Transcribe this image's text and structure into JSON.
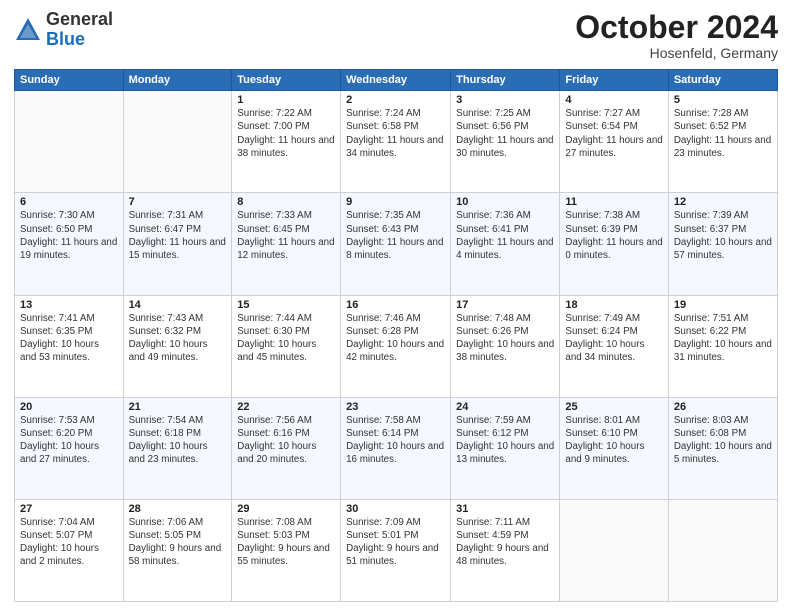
{
  "header": {
    "logo_general": "General",
    "logo_blue": "Blue",
    "month_title": "October 2024",
    "location": "Hosenfeld, Germany"
  },
  "weekdays": [
    "Sunday",
    "Monday",
    "Tuesday",
    "Wednesday",
    "Thursday",
    "Friday",
    "Saturday"
  ],
  "weeks": [
    [
      {
        "day": "",
        "info": ""
      },
      {
        "day": "",
        "info": ""
      },
      {
        "day": "1",
        "info": "Sunrise: 7:22 AM\nSunset: 7:00 PM\nDaylight: 11 hours and 38 minutes."
      },
      {
        "day": "2",
        "info": "Sunrise: 7:24 AM\nSunset: 6:58 PM\nDaylight: 11 hours and 34 minutes."
      },
      {
        "day": "3",
        "info": "Sunrise: 7:25 AM\nSunset: 6:56 PM\nDaylight: 11 hours and 30 minutes."
      },
      {
        "day": "4",
        "info": "Sunrise: 7:27 AM\nSunset: 6:54 PM\nDaylight: 11 hours and 27 minutes."
      },
      {
        "day": "5",
        "info": "Sunrise: 7:28 AM\nSunset: 6:52 PM\nDaylight: 11 hours and 23 minutes."
      }
    ],
    [
      {
        "day": "6",
        "info": "Sunrise: 7:30 AM\nSunset: 6:50 PM\nDaylight: 11 hours and 19 minutes."
      },
      {
        "day": "7",
        "info": "Sunrise: 7:31 AM\nSunset: 6:47 PM\nDaylight: 11 hours and 15 minutes."
      },
      {
        "day": "8",
        "info": "Sunrise: 7:33 AM\nSunset: 6:45 PM\nDaylight: 11 hours and 12 minutes."
      },
      {
        "day": "9",
        "info": "Sunrise: 7:35 AM\nSunset: 6:43 PM\nDaylight: 11 hours and 8 minutes."
      },
      {
        "day": "10",
        "info": "Sunrise: 7:36 AM\nSunset: 6:41 PM\nDaylight: 11 hours and 4 minutes."
      },
      {
        "day": "11",
        "info": "Sunrise: 7:38 AM\nSunset: 6:39 PM\nDaylight: 11 hours and 0 minutes."
      },
      {
        "day": "12",
        "info": "Sunrise: 7:39 AM\nSunset: 6:37 PM\nDaylight: 10 hours and 57 minutes."
      }
    ],
    [
      {
        "day": "13",
        "info": "Sunrise: 7:41 AM\nSunset: 6:35 PM\nDaylight: 10 hours and 53 minutes."
      },
      {
        "day": "14",
        "info": "Sunrise: 7:43 AM\nSunset: 6:32 PM\nDaylight: 10 hours and 49 minutes."
      },
      {
        "day": "15",
        "info": "Sunrise: 7:44 AM\nSunset: 6:30 PM\nDaylight: 10 hours and 45 minutes."
      },
      {
        "day": "16",
        "info": "Sunrise: 7:46 AM\nSunset: 6:28 PM\nDaylight: 10 hours and 42 minutes."
      },
      {
        "day": "17",
        "info": "Sunrise: 7:48 AM\nSunset: 6:26 PM\nDaylight: 10 hours and 38 minutes."
      },
      {
        "day": "18",
        "info": "Sunrise: 7:49 AM\nSunset: 6:24 PM\nDaylight: 10 hours and 34 minutes."
      },
      {
        "day": "19",
        "info": "Sunrise: 7:51 AM\nSunset: 6:22 PM\nDaylight: 10 hours and 31 minutes."
      }
    ],
    [
      {
        "day": "20",
        "info": "Sunrise: 7:53 AM\nSunset: 6:20 PM\nDaylight: 10 hours and 27 minutes."
      },
      {
        "day": "21",
        "info": "Sunrise: 7:54 AM\nSunset: 6:18 PM\nDaylight: 10 hours and 23 minutes."
      },
      {
        "day": "22",
        "info": "Sunrise: 7:56 AM\nSunset: 6:16 PM\nDaylight: 10 hours and 20 minutes."
      },
      {
        "day": "23",
        "info": "Sunrise: 7:58 AM\nSunset: 6:14 PM\nDaylight: 10 hours and 16 minutes."
      },
      {
        "day": "24",
        "info": "Sunrise: 7:59 AM\nSunset: 6:12 PM\nDaylight: 10 hours and 13 minutes."
      },
      {
        "day": "25",
        "info": "Sunrise: 8:01 AM\nSunset: 6:10 PM\nDaylight: 10 hours and 9 minutes."
      },
      {
        "day": "26",
        "info": "Sunrise: 8:03 AM\nSunset: 6:08 PM\nDaylight: 10 hours and 5 minutes."
      }
    ],
    [
      {
        "day": "27",
        "info": "Sunrise: 7:04 AM\nSunset: 5:07 PM\nDaylight: 10 hours and 2 minutes."
      },
      {
        "day": "28",
        "info": "Sunrise: 7:06 AM\nSunset: 5:05 PM\nDaylight: 9 hours and 58 minutes."
      },
      {
        "day": "29",
        "info": "Sunrise: 7:08 AM\nSunset: 5:03 PM\nDaylight: 9 hours and 55 minutes."
      },
      {
        "day": "30",
        "info": "Sunrise: 7:09 AM\nSunset: 5:01 PM\nDaylight: 9 hours and 51 minutes."
      },
      {
        "day": "31",
        "info": "Sunrise: 7:11 AM\nSunset: 4:59 PM\nDaylight: 9 hours and 48 minutes."
      },
      {
        "day": "",
        "info": ""
      },
      {
        "day": "",
        "info": ""
      }
    ]
  ]
}
